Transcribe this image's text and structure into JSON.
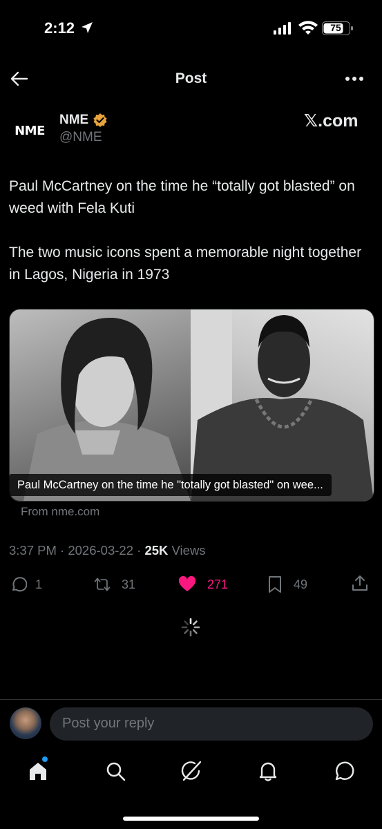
{
  "status_bar": {
    "time": "2:12",
    "battery": "75"
  },
  "header": {
    "title": "Post"
  },
  "author": {
    "avatar_text": "NME",
    "name": "NME",
    "handle": "@NME"
  },
  "source_logo": "𝕏.com",
  "post": {
    "paragraph_1": "Paul McCartney on the time he “totally got blasted” on weed with Fela Kuti",
    "paragraph_2": "The two music icons spent a memorable night together in Lagos, Nigeria in 1973"
  },
  "card": {
    "caption": "Paul McCartney on the time he \"totally got blasted\" on wee...",
    "source": "From nme.com"
  },
  "meta": {
    "time": "3:37 PM",
    "date": "2026-03-22",
    "views_count": "25K",
    "views_label": "Views",
    "separator": "·"
  },
  "actions": {
    "replies": "1",
    "reposts": "31",
    "likes": "271",
    "bookmarks": "49"
  },
  "reply": {
    "placeholder": "Post your reply"
  },
  "colors": {
    "background": "#000000",
    "text": "#e7e9ea",
    "muted": "#71767b",
    "like": "#f91880",
    "accent": "#1d9bf0",
    "verified": "#e8a33d"
  },
  "icons": {
    "status": [
      "location-arrow-icon",
      "signal-icon",
      "wifi-icon",
      "battery-icon"
    ],
    "header": [
      "back-arrow-icon",
      "more-icon"
    ],
    "actions": [
      "reply-icon",
      "repost-icon",
      "like-icon",
      "bookmark-icon",
      "share-icon"
    ],
    "nav": [
      "home-icon",
      "search-icon",
      "grok-icon",
      "notifications-icon",
      "messages-icon"
    ]
  }
}
